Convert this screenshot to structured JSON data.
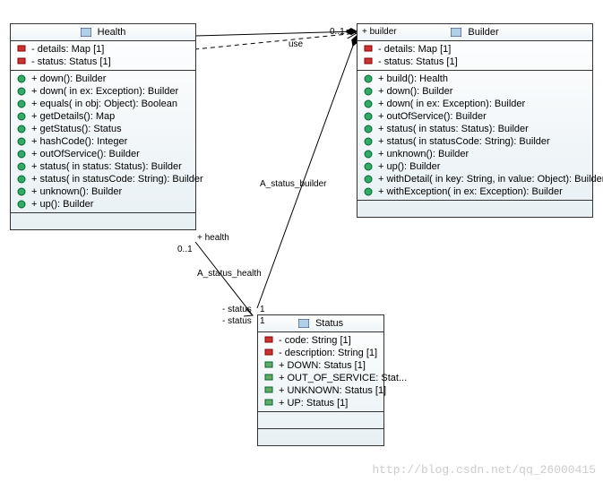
{
  "classes": {
    "health": {
      "name": "Health",
      "attributes": [
        "- details: Map [1]",
        "- status: Status [1]"
      ],
      "operations": [
        "+ down(): Builder",
        "+ down(  in ex: Exception): Builder",
        "+ equals(  in obj: Object): Boolean",
        "+ getDetails(): Map",
        "+ getStatus(): Status",
        "+ hashCode(): Integer",
        "+ outOfService(): Builder",
        "+ status(  in status: Status): Builder",
        "+ status(  in statusCode: String): Builder",
        "+ unknown(): Builder",
        "+ up(): Builder"
      ]
    },
    "builder": {
      "name": "Builder",
      "attributes": [
        "- details: Map [1]",
        "- status: Status [1]"
      ],
      "operations": [
        "+ build(): Health",
        "+ down(): Builder",
        "+ down(  in ex: Exception): Builder",
        "+ outOfService(): Builder",
        "+ status(  in status: Status): Builder",
        "+ status(  in statusCode: String): Builder",
        "+ unknown(): Builder",
        "+ up(): Builder",
        "+ withDetail(  in key: String,   in value: Object): Builder",
        "+ withException(  in ex: Exception): Builder"
      ]
    },
    "status": {
      "name": "Status",
      "attributes": [
        "- code: String [1]",
        "- description: String [1]",
        "+ DOWN: Status [1]",
        "+ OUT_OF_SERVICE: Stat...",
        "+ UNKNOWN: Status [1]",
        "+ UP: Status [1]"
      ]
    }
  },
  "labels": {
    "use": "use",
    "builder_role": "+ builder",
    "mult_01_a": "0..1",
    "mult_01_b": "0..1",
    "health_role": "+ health",
    "a_status_builder": "A_status_builder",
    "a_status_health": "A_status_health",
    "status_role1": "- status",
    "status_role2": "- status",
    "mult1a": "1",
    "mult1b": "1"
  },
  "watermark": "http://blog.csdn.net/qq_26000415"
}
